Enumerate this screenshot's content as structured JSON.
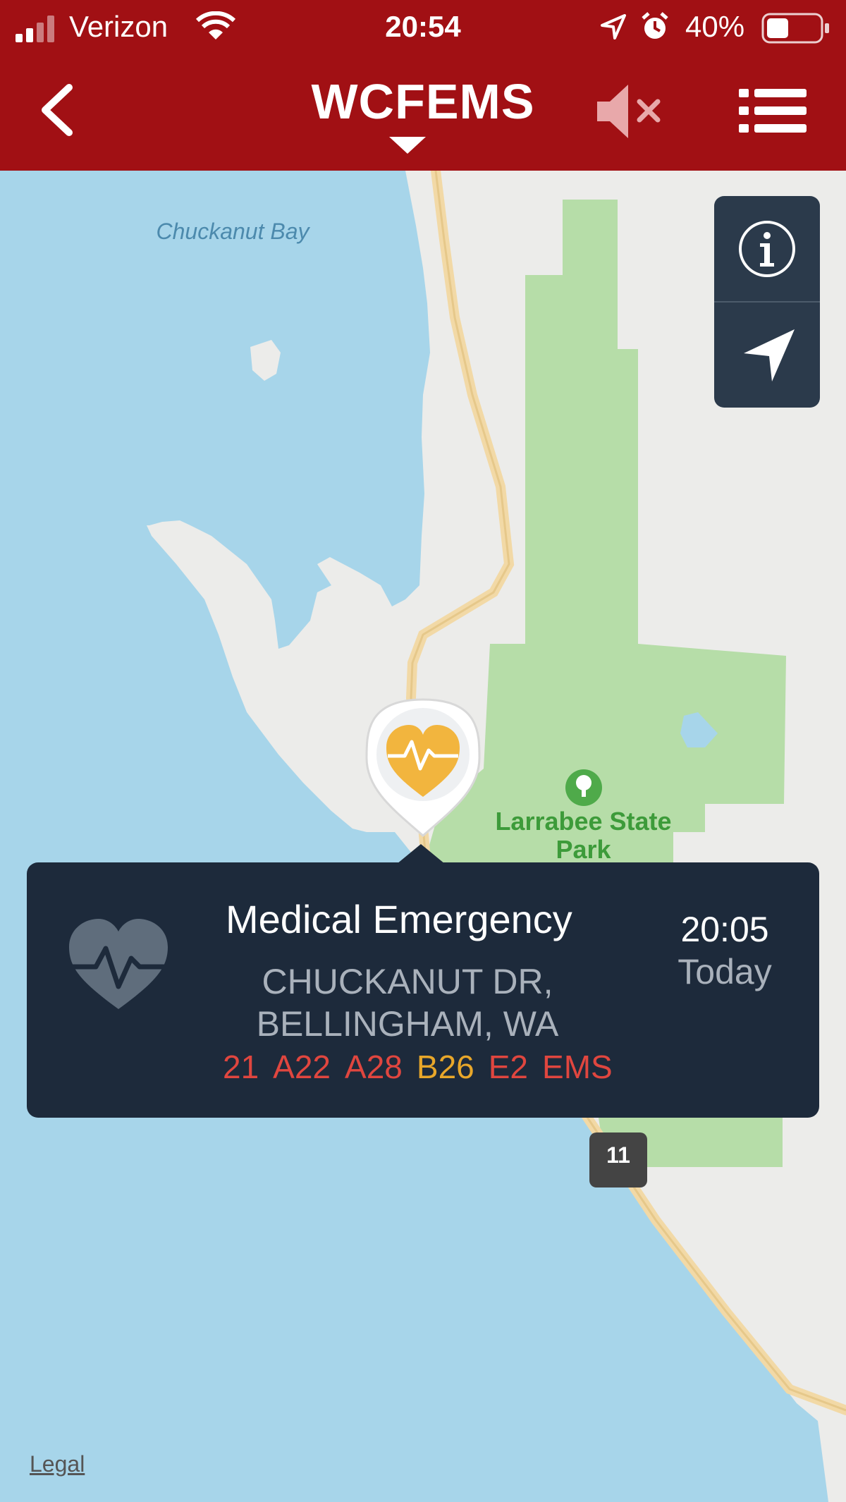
{
  "status_bar": {
    "carrier": "Verizon",
    "time": "20:54",
    "battery_percent": "40%"
  },
  "nav": {
    "title": "WCFEMS"
  },
  "map": {
    "labels": {
      "bay": "Chuckanut Bay",
      "park": "Larrabee State Park"
    },
    "highway_number": "11",
    "legal": "Legal"
  },
  "incident": {
    "title": "Medical Emergency",
    "address_line1": "CHUCKANUT DR,",
    "address_line2": "BELLINGHAM, WA",
    "time": "20:05",
    "day": "Today",
    "units": [
      {
        "label": "21",
        "color": "#e0463f"
      },
      {
        "label": "A22",
        "color": "#e0463f"
      },
      {
        "label": "A28",
        "color": "#e0463f"
      },
      {
        "label": "B26",
        "color": "#e8a72a"
      },
      {
        "label": "E2",
        "color": "#e0463f"
      },
      {
        "label": "EMS",
        "color": "#e0463f"
      }
    ]
  },
  "colors": {
    "header": "#a11014",
    "water": "#a7d5ea",
    "land": "#ececea",
    "park": "#b6dda8",
    "road": "#f2d9a6",
    "callout": "#1d2a3b",
    "pin_heart": "#f2b53e"
  }
}
